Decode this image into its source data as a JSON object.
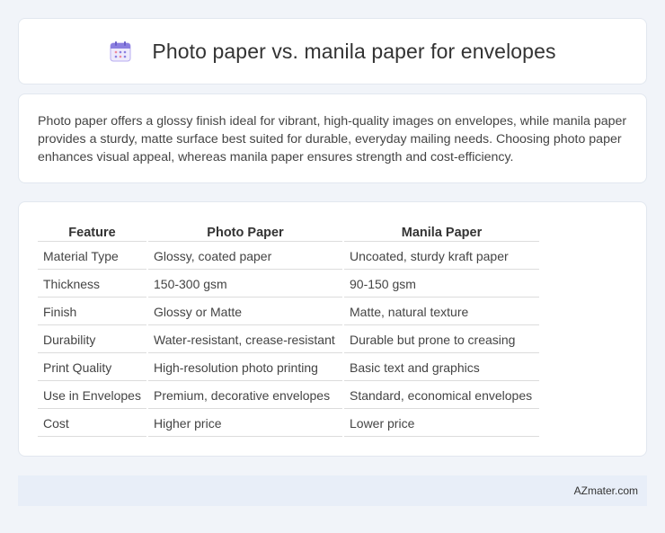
{
  "header": {
    "title": "Photo paper vs. manila paper for envelopes",
    "icon": "calendar-icon"
  },
  "summary": {
    "text": "Photo paper offers a glossy finish ideal for vibrant, high-quality images on envelopes, while manila paper provides a sturdy, matte surface best suited for durable, everyday mailing needs. Choosing photo paper enhances visual appeal, whereas manila paper ensures strength and cost-efficiency."
  },
  "table": {
    "headers": [
      "Feature",
      "Photo Paper",
      "Manila Paper"
    ],
    "rows": [
      [
        "Material Type",
        "Glossy, coated paper",
        "Uncoated, sturdy kraft paper"
      ],
      [
        "Thickness",
        "150-300 gsm",
        "90-150 gsm"
      ],
      [
        "Finish",
        "Glossy or Matte",
        "Matte, natural texture"
      ],
      [
        "Durability",
        "Water-resistant, crease-resistant",
        "Durable but prone to creasing"
      ],
      [
        "Print Quality",
        "High-resolution photo printing",
        "Basic text and graphics"
      ],
      [
        "Use in Envelopes",
        "Premium, decorative envelopes",
        "Standard, economical envelopes"
      ],
      [
        "Cost",
        "Higher price",
        "Lower price"
      ]
    ]
  },
  "footer": {
    "brand": "AZmater.com"
  },
  "colors": {
    "background": "#f1f4f9",
    "card": "#ffffff",
    "footer": "#e8eef8",
    "icon_accent": "#8b7fe0"
  }
}
